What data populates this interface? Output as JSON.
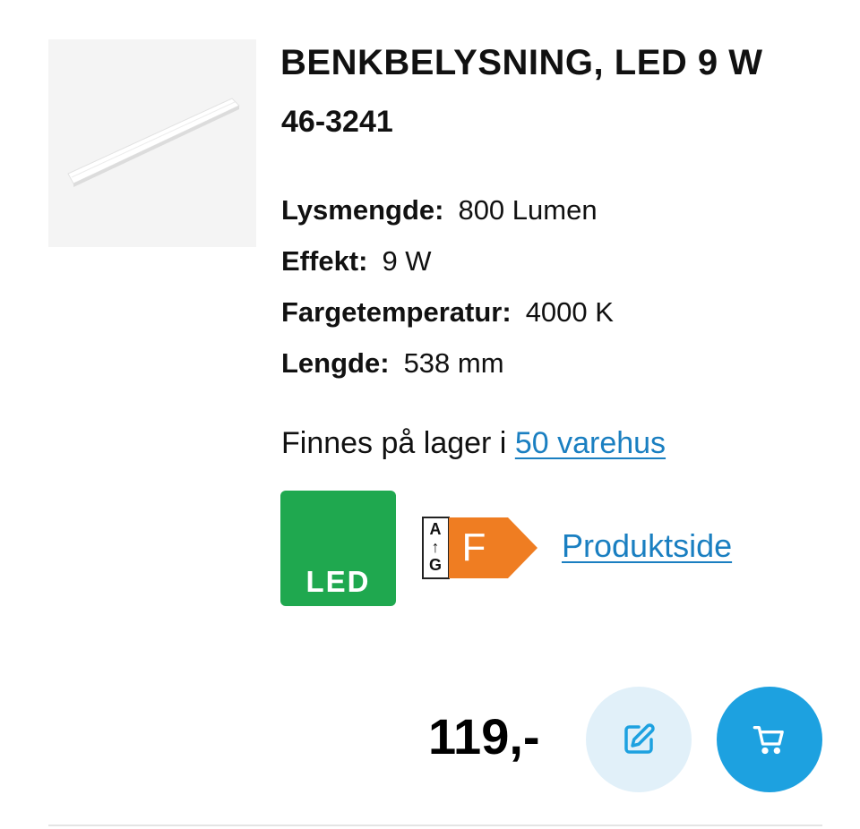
{
  "product": {
    "title": "BENKBELYSNING, LED 9 W",
    "article_number": "46-3241",
    "image_icon": "led-light-bar-image"
  },
  "specs": [
    {
      "label": "Lysmengde:",
      "value": "800 Lumen"
    },
    {
      "label": "Effekt:",
      "value": "9 W"
    },
    {
      "label": "Fargetemperatur:",
      "value": "4000 K"
    },
    {
      "label": "Lengde:",
      "value": "538 mm"
    }
  ],
  "stock": {
    "prefix": "Finnes på lager i",
    "link_label": "50 varehus"
  },
  "badges": {
    "led_label": "LED",
    "energy_scale_top": "A",
    "energy_scale_arrow": "↑",
    "energy_scale_bottom": "G",
    "energy_class": "F"
  },
  "links": {
    "product_page": "Produktside"
  },
  "price": "119,-",
  "actions": {
    "edit_icon": "edit-icon",
    "cart_icon": "shopping-cart-icon"
  },
  "colors": {
    "link": "#1a7fc1",
    "led_badge": "#1fa84f",
    "energy_class_f": "#ef7d22",
    "cart_button": "#1da1e0",
    "edit_button": "#e1f0f9"
  }
}
